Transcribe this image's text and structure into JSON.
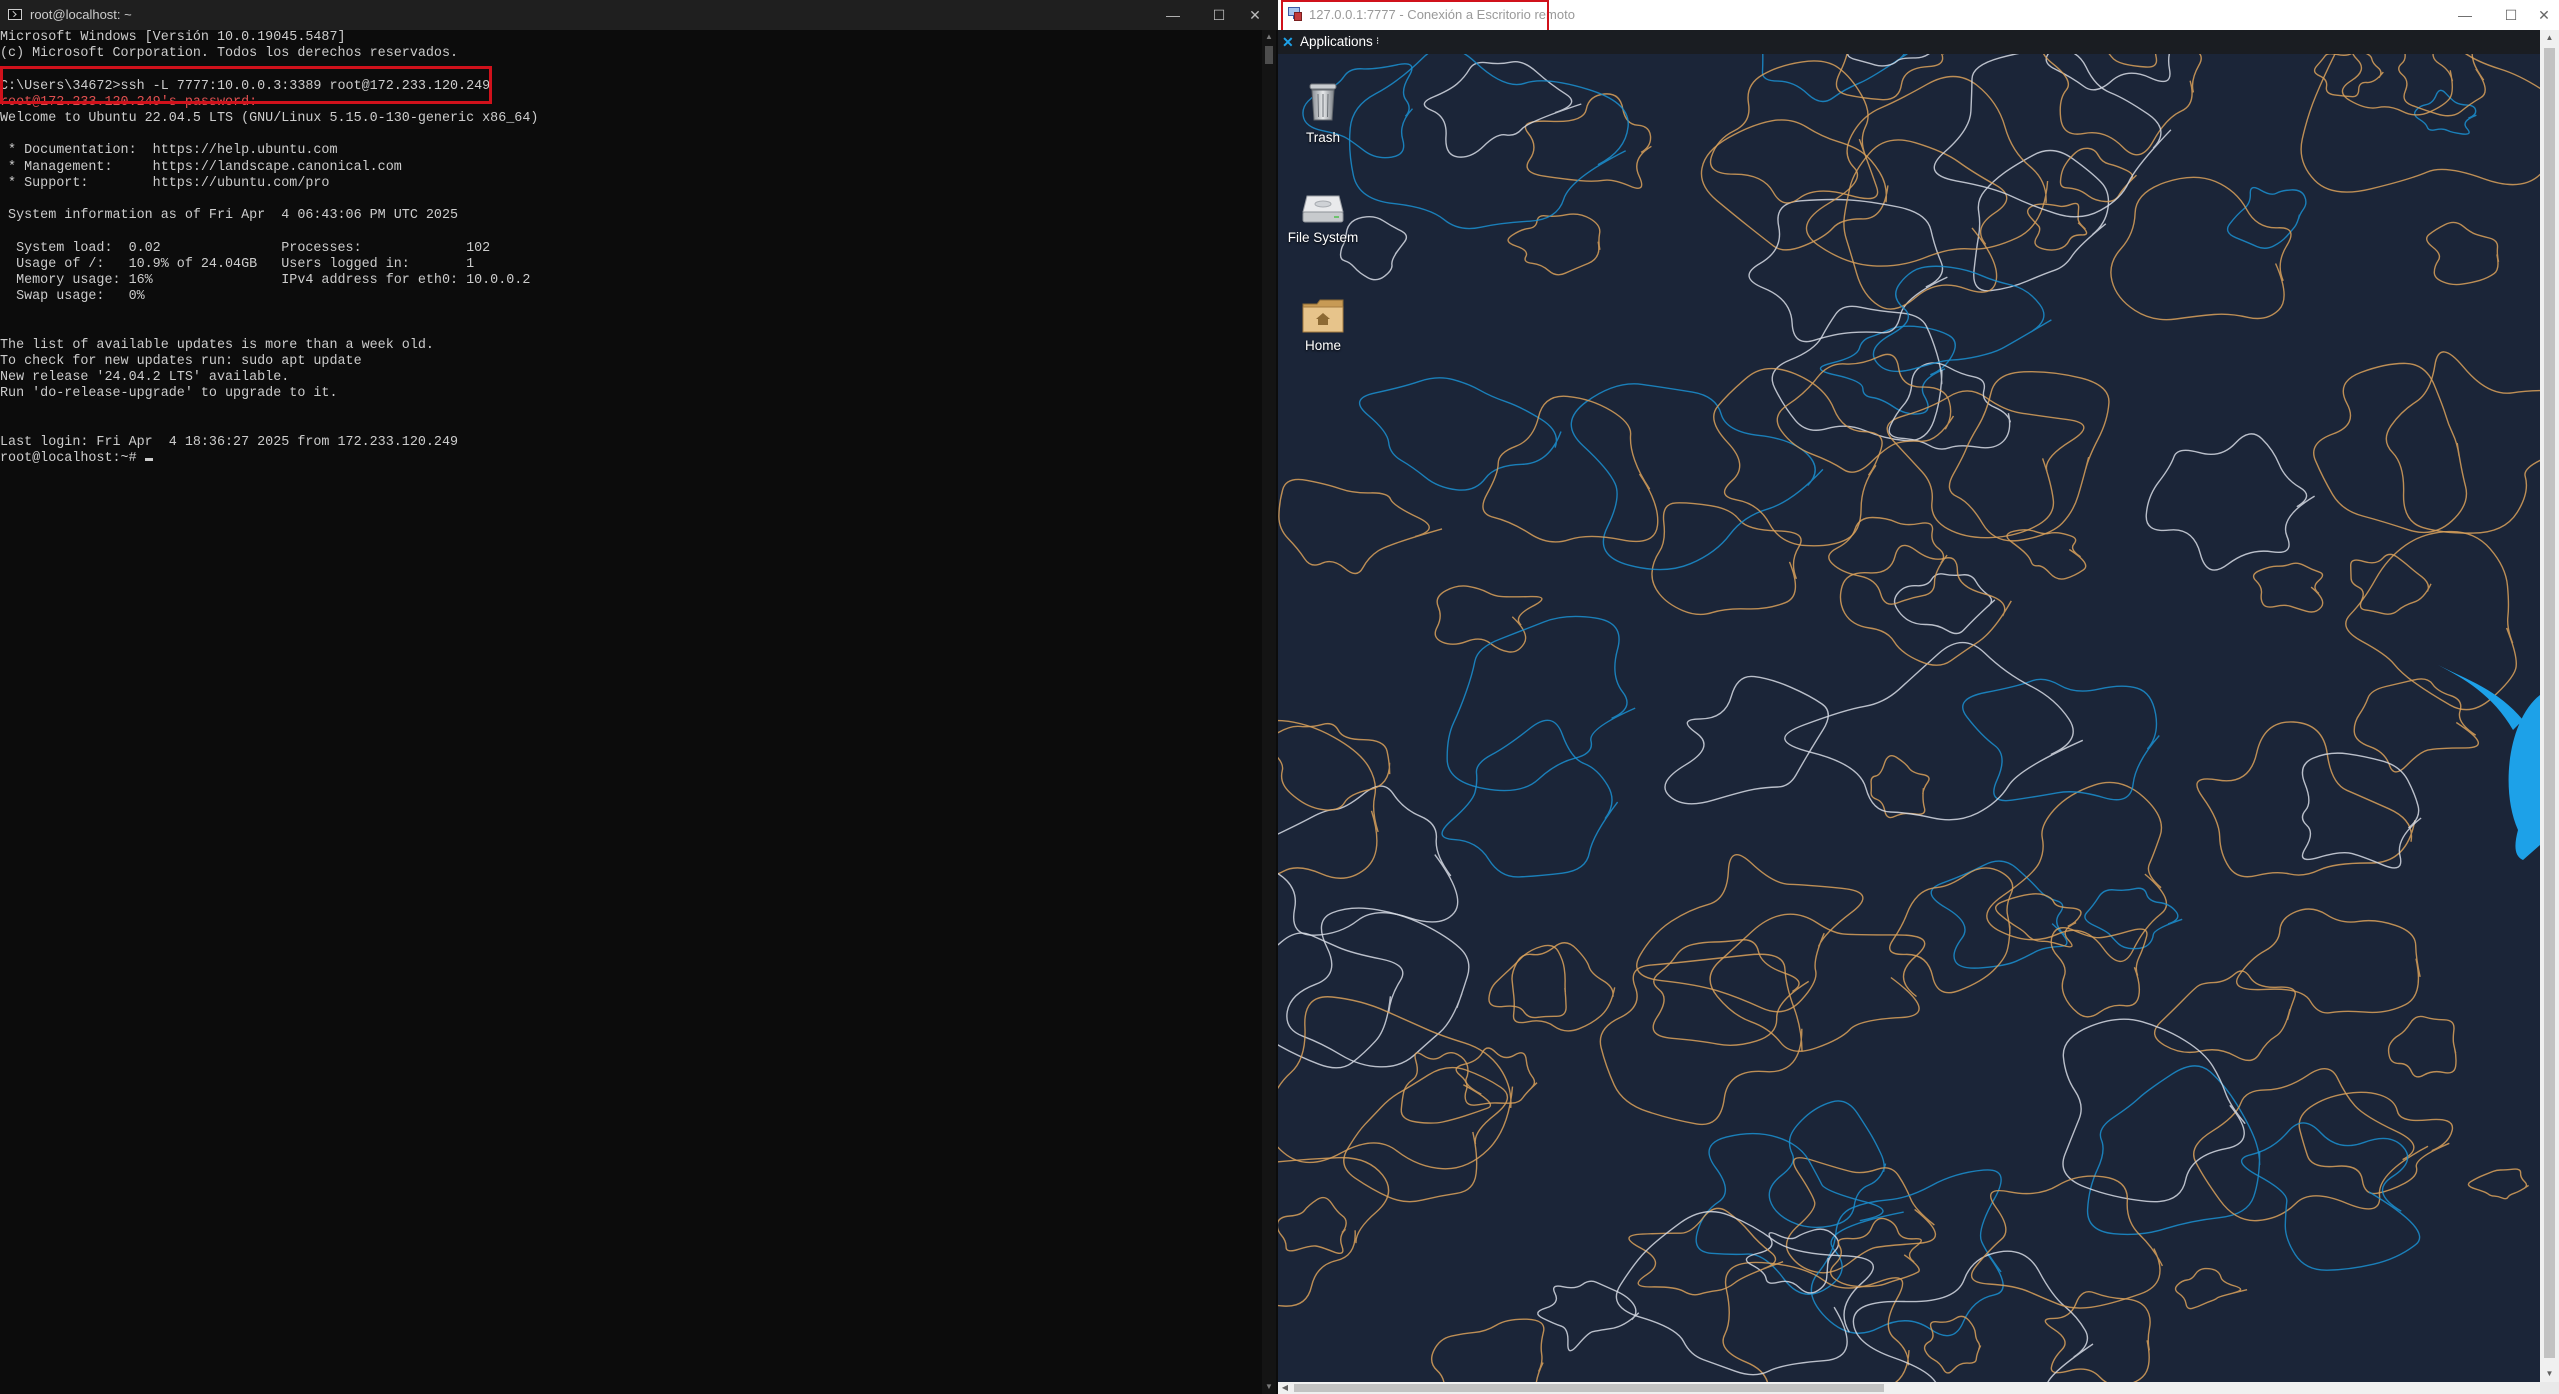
{
  "terminal": {
    "title": "root@localhost: ~",
    "window_controls": {
      "minimize": "—",
      "maximize": "☐",
      "close": "✕"
    },
    "lines": [
      {
        "text": "Microsoft Windows [Versión 10.0.19045.5487]",
        "style": "normal"
      },
      {
        "text": "(c) Microsoft Corporation. Todos los derechos reservados.",
        "style": "normal"
      },
      {
        "text": "",
        "style": "normal"
      },
      {
        "text": "C:\\Users\\34672>ssh -L 7777:10.0.0.3:3389 root@172.233.120.249",
        "style": "normal"
      },
      {
        "text": "root@172.233.120.249's password:",
        "style": "red"
      },
      {
        "text": "Welcome to Ubuntu 22.04.5 LTS (GNU/Linux 5.15.0-130-generic x86_64)",
        "style": "normal"
      },
      {
        "text": "",
        "style": "normal"
      },
      {
        "text": " * Documentation:  https://help.ubuntu.com",
        "style": "normal"
      },
      {
        "text": " * Management:     https://landscape.canonical.com",
        "style": "normal"
      },
      {
        "text": " * Support:        https://ubuntu.com/pro",
        "style": "normal"
      },
      {
        "text": "",
        "style": "normal"
      },
      {
        "text": " System information as of Fri Apr  4 06:43:06 PM UTC 2025",
        "style": "normal"
      },
      {
        "text": "",
        "style": "normal"
      },
      {
        "text": "  System load:  0.02               Processes:             102",
        "style": "normal"
      },
      {
        "text": "  Usage of /:   10.9% of 24.04GB   Users logged in:       1",
        "style": "normal"
      },
      {
        "text": "  Memory usage: 16%                IPv4 address for eth0: 10.0.0.2",
        "style": "normal"
      },
      {
        "text": "  Swap usage:   0%",
        "style": "normal"
      },
      {
        "text": "",
        "style": "normal"
      },
      {
        "text": "",
        "style": "normal"
      },
      {
        "text": "The list of available updates is more than a week old.",
        "style": "normal"
      },
      {
        "text": "To check for new updates run: sudo apt update",
        "style": "normal"
      },
      {
        "text": "New release '24.04.2 LTS' available.",
        "style": "normal"
      },
      {
        "text": "Run 'do-release-upgrade' to upgrade to it.",
        "style": "normal"
      },
      {
        "text": "",
        "style": "normal"
      },
      {
        "text": "",
        "style": "normal"
      },
      {
        "text": "Last login: Fri Apr  4 18:36:27 2025 from 172.233.120.249",
        "style": "normal"
      },
      {
        "text": "root@localhost:~# ",
        "style": "prompt"
      }
    ]
  },
  "rdp": {
    "title": "127.0.0.1:7777 - Conexión a Escritorio remoto",
    "window_controls": {
      "minimize": "—",
      "maximize": "☐",
      "close": "✕"
    },
    "panel": {
      "applications_label": "Applications",
      "menu_arrow": "⁝"
    },
    "desktop_icons": [
      {
        "label": "Trash",
        "icon": "trash-icon"
      },
      {
        "label": "File System",
        "icon": "drive-icon"
      },
      {
        "label": "Home",
        "icon": "home-folder-icon"
      }
    ],
    "colors": {
      "wallpaper_bg": "#1b2538",
      "contour_orange": "#d9a15a",
      "contour_white": "#d6dbe4",
      "contour_blue": "#1a8fd0",
      "mouse_blue": "#1da1e8"
    }
  }
}
